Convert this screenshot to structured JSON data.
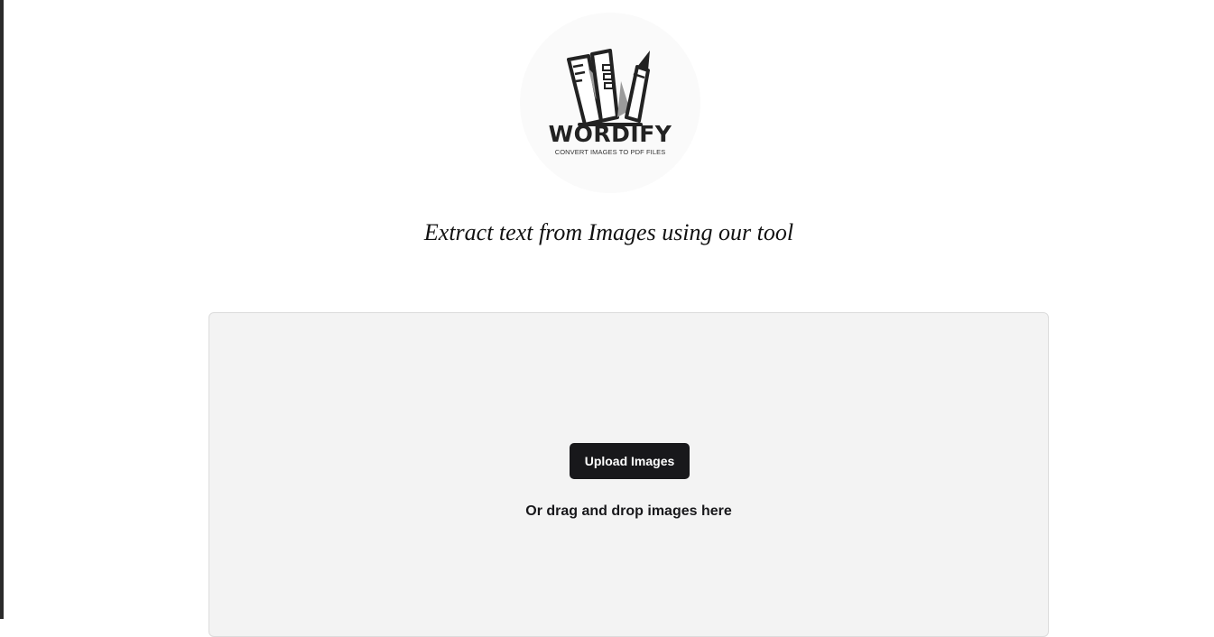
{
  "brand": {
    "name": "WORDIFY",
    "tagline": "CONVERT IMAGES TO PDF FILES",
    "logo_icon": "w-book-pencil-logo",
    "text_color": "#222222"
  },
  "hero": {
    "headline": "Extract text from Images using our tool"
  },
  "uploader": {
    "button_label": "Upload Images",
    "drag_hint": "Or drag and drop images here",
    "button_color": "#18181b",
    "zone_color": "#f3f3f3"
  }
}
